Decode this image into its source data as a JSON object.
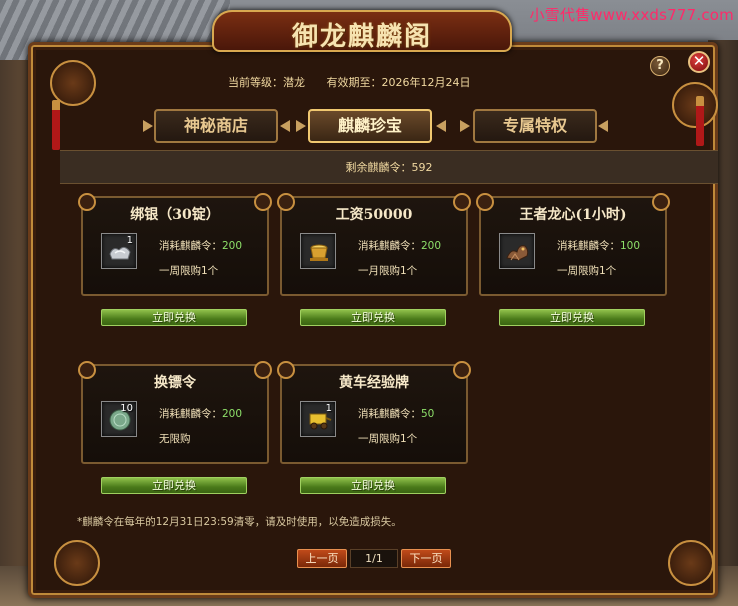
{
  "watermark": "小雪代售www.xxds777.com",
  "window": {
    "title": "御龙麒麟阁"
  },
  "header": {
    "level_label": "当前等级：潜龙",
    "expiry_label": "有效期至：2026年12月24日"
  },
  "controls": {
    "help": "?",
    "close": "✕"
  },
  "tabs": [
    {
      "label": "神秘商店",
      "active": false
    },
    {
      "label": "麒麟珍宝",
      "active": true
    },
    {
      "label": "专属特权",
      "active": false
    }
  ],
  "remaining": "剩余麒麟令：592",
  "items": [
    {
      "title": "绑银（30锭）",
      "qty": "1",
      "cost_label": "消耗麒麟令：",
      "cost": "200",
      "limit": "一周限购1个",
      "icon": "silver-ingot-icon",
      "button": "立即兑换"
    },
    {
      "title": "工资50000",
      "qty": "",
      "cost_label": "消耗麒麟令：",
      "cost": "200",
      "limit": "一月限购1个",
      "icon": "gold-bowl-icon",
      "button": "立即兑换"
    },
    {
      "title": "王者龙心(1小时)",
      "qty": "",
      "cost_label": "消耗麒麟令：",
      "cost": "100",
      "limit": "一周限购1个",
      "icon": "dragon-heart-icon",
      "button": "立即兑换"
    },
    {
      "title": "换镖令",
      "qty": "10",
      "cost_label": "消耗麒麟令：",
      "cost": "200",
      "limit": "无限购",
      "icon": "jade-token-icon",
      "button": "立即兑换"
    },
    {
      "title": "黄车经验牌",
      "qty": "1",
      "cost_label": "消耗麒麟令：",
      "cost": "50",
      "limit": "一周限购1个",
      "icon": "yellow-cart-icon",
      "button": "立即兑换"
    }
  ],
  "note": "*麒麟令在每年的12月31日23:59清零，请及时使用，以免造成损失。",
  "pager": {
    "prev": "上一页",
    "page": "1/1",
    "next": "下一页"
  }
}
